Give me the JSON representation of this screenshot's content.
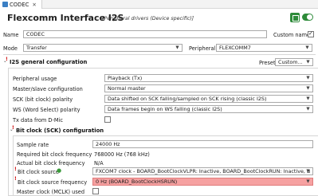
{
  "tab": {
    "label": "CODEC",
    "close": "✕"
  },
  "header": {
    "title": "Flexcomm Interface I2S",
    "subtitle": "[Peripheral drivers (Device specific)]"
  },
  "name_row": {
    "label": "Name",
    "value": "CODEC",
    "custom_name_label": "Custom name",
    "custom_name_checked": true
  },
  "mode_row": {
    "label": "Mode",
    "value": "Transfer",
    "peripheral_label": "Peripheral",
    "peripheral_value": "FLEXCOMM7"
  },
  "general": {
    "title": "I2S general configuration",
    "preset_label": "Preset",
    "preset_value": "Custom...",
    "rows": [
      {
        "label": "Peripheral usage",
        "value": "Playback (Tx)"
      },
      {
        "label": "Master/slave configuration",
        "value": "Normal master"
      },
      {
        "label": "SCK (bit clock) polarity",
        "value": "Data shifted on SCK falling/sampled on SCK rising (classic I2S)"
      },
      {
        "label": "WS (Word Select) polarity",
        "value": "Data frames begin on WS falling (classic I2S)"
      },
      {
        "label": "Tx data from D-Mic",
        "checked": false
      }
    ]
  },
  "bitclock": {
    "title": "Bit clock (SCK) configuration",
    "sample_rate_label": "Sample rate",
    "sample_rate_value": "24000 Hz",
    "required_label": "Required bit clock frequency",
    "required_value": "768000 Hz (768 kHz)",
    "actual_label": "Actual bit clock frequency",
    "actual_value": "N/A",
    "source_label": "Bit clock source",
    "source_value": "FXCOM7 clock - BOARD_BootClockVLPR: Inactive, BOARD_BootClockRUN: Inactive, BO",
    "source_freq_label": "Bit clock source frequency",
    "source_freq_value": "0 Hz (BOARD_BootClockHSRUN)",
    "mclk_label": "Master clock (MCLK) used",
    "mclk_checked": false
  },
  "colors": {
    "accent_green": "#2e8b3a",
    "error_red": "#cc0000",
    "error_field": "#f6a1a1"
  }
}
